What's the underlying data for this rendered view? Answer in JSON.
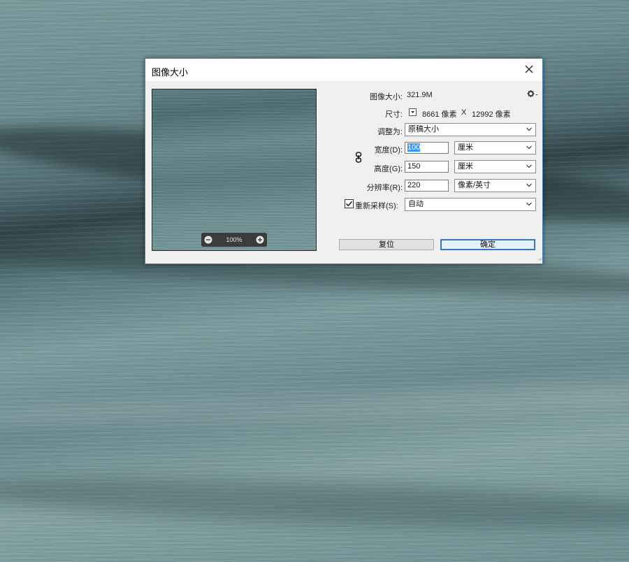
{
  "dialog": {
    "title": "图像大小",
    "close_icon": "close-icon",
    "preview": {
      "zoom_level": "100%",
      "zoom_out_icon": "zoom-out-icon",
      "zoom_in_icon": "zoom-in-icon"
    },
    "image_size": {
      "label": "图像大小:",
      "value": "321.9M"
    },
    "settings_icon": "gear-icon",
    "dimensions": {
      "label": "尺寸:",
      "width_px": "8661 像素",
      "separator": "X",
      "height_px": "12992 像素"
    },
    "fit_to": {
      "label": "调整为:",
      "value": "原稿大小"
    },
    "link_icon": "chain-link-icon",
    "width": {
      "label": "宽度(D):",
      "value": "100",
      "unit": "厘米"
    },
    "height": {
      "label": "高度(G):",
      "value": "150",
      "unit": "厘米"
    },
    "resolution": {
      "label": "分辨率(R):",
      "value": "220",
      "unit": "像素/英寸"
    },
    "resample": {
      "checked": true,
      "label": "重新采样(S):",
      "value": "自动"
    },
    "buttons": {
      "reset": "复位",
      "ok": "确定"
    }
  }
}
